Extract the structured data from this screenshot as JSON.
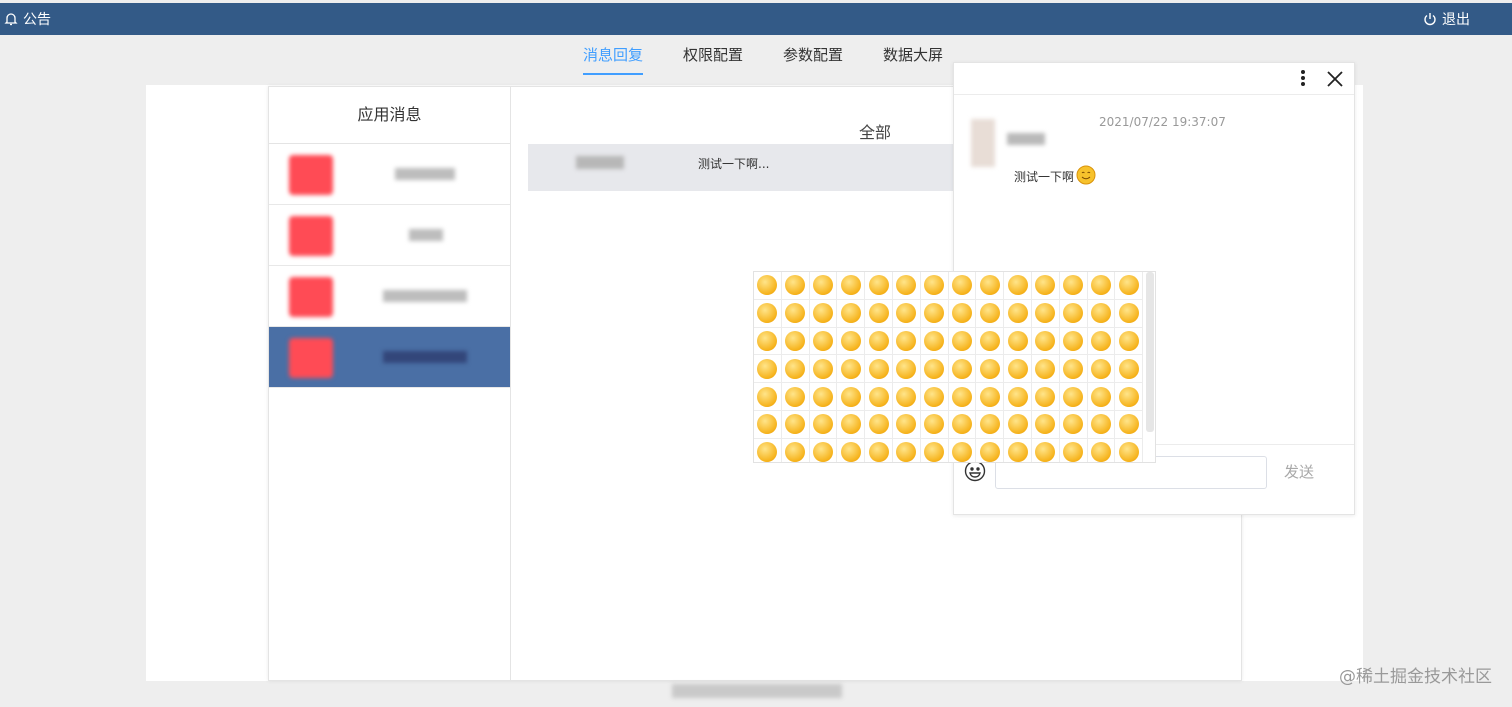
{
  "topbar": {
    "notice_label": "公告",
    "logout_label": "退出",
    "bg_color": "#335a87"
  },
  "tabs": [
    {
      "label": "消息回复",
      "active": true
    },
    {
      "label": "权限配置",
      "active": false
    },
    {
      "label": "参数配置",
      "active": false
    },
    {
      "label": "数据大屏",
      "active": false
    }
  ],
  "left_panel": {
    "title": "应用消息",
    "items_count": 4,
    "selected_index": 3
  },
  "right_panel": {
    "title": "全部",
    "messages": [
      {
        "preview": "测试一下啊..."
      }
    ]
  },
  "chat": {
    "time": "2021/07/22 19:37:07",
    "message_text": "测试一下啊",
    "input_value": "",
    "send_label": "发送"
  },
  "emoji_panel": {
    "rows": 7,
    "cols": 14
  },
  "watermark": "@稀土掘金技术社区",
  "accent_color": "#409eff"
}
